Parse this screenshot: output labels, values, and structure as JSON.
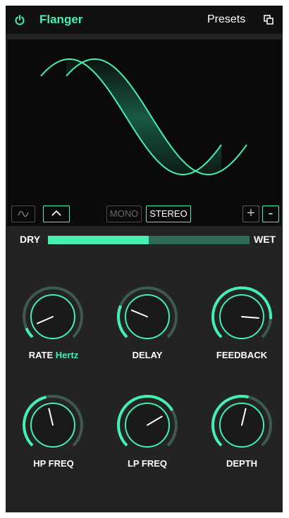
{
  "header": {
    "title": "Flanger",
    "presets_label": "Presets",
    "power_icon": "power-icon",
    "copy_icon": "copy-icon",
    "accent_color": "#44f0b0"
  },
  "display": {
    "waveform_buttons": [
      {
        "icon": "sine-wave-icon",
        "selected": false
      },
      {
        "icon": "triangle-wave-icon",
        "selected": true
      }
    ],
    "mode_buttons": [
      {
        "label": "MONO",
        "selected": false
      },
      {
        "label": "STEREO",
        "selected": true
      }
    ],
    "plus_label": "+",
    "minus_label": "-"
  },
  "mix": {
    "dry_label": "DRY",
    "wet_label": "WET",
    "value": 0.5
  },
  "knobs": [
    {
      "label": "RATE",
      "unit": "Hertz",
      "value": 0.08
    },
    {
      "label": "DELAY",
      "unit": "",
      "value": 0.25
    },
    {
      "label": "FEEDBACK",
      "unit": "",
      "value": 0.85
    },
    {
      "label": "HP FREQ",
      "unit": "",
      "value": 0.45
    },
    {
      "label": "LP FREQ",
      "unit": "",
      "value": 0.72
    },
    {
      "label": "DEPTH",
      "unit": "",
      "value": 0.55
    }
  ]
}
